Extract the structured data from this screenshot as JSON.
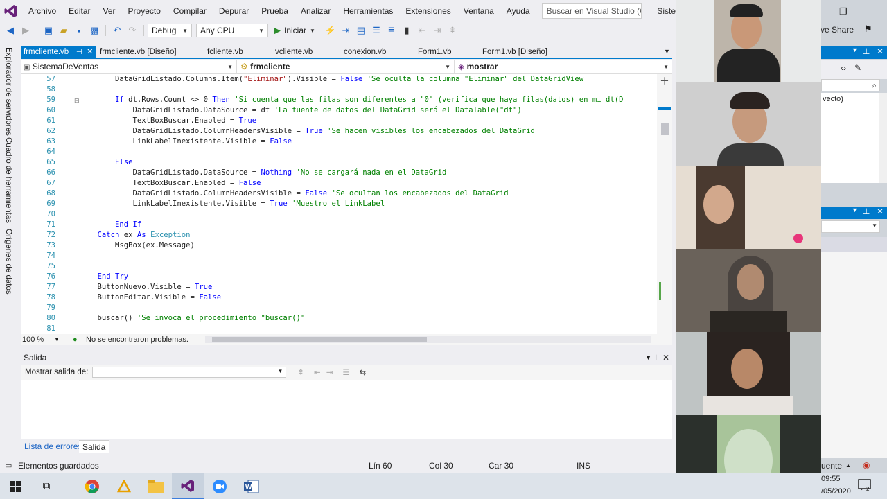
{
  "menu": [
    "Archivo",
    "Editar",
    "Ver",
    "Proyecto",
    "Compilar",
    "Depurar",
    "Prueba",
    "Analizar",
    "Herramientas",
    "Extensiones",
    "Ventana",
    "Ayuda"
  ],
  "search_placeholder": "Buscar en Visual Studio (Ctrl...",
  "search_suffix": "Siste",
  "toolbar": {
    "config": "Debug",
    "platform": "Any CPU",
    "start": "Iniciar"
  },
  "left_tabs": [
    "Explorador de servidores",
    "Cuadro de herramientas",
    "Orígenes de datos"
  ],
  "doc_tabs": [
    {
      "label": "frmcliente.vb",
      "active": true
    },
    {
      "label": "frmcliente.vb [Diseño]"
    },
    {
      "label": "fcliente.vb"
    },
    {
      "label": "vcliente.vb"
    },
    {
      "label": "conexion.vb"
    },
    {
      "label": "Form1.vb"
    },
    {
      "label": "Form1.vb [Diseño]"
    }
  ],
  "nav": {
    "project": "SistemaDeVentas",
    "class": "frmcliente",
    "member": "mostrar"
  },
  "code_lines": [
    {
      "n": "57",
      "t": [
        [
          "",
          "        DataGridListado.Columns.Item("
        ],
        [
          "st",
          "\"Eliminar\""
        ],
        [
          "",
          ").Visible = "
        ],
        [
          "kw",
          "False"
        ],
        [
          "cm",
          " 'Se oculta la columna \"Eliminar\" del DataGridView"
        ]
      ]
    },
    {
      "n": "58",
      "t": []
    },
    {
      "n": "59",
      "t": [
        [
          "kw",
          "        If"
        ],
        [
          "",
          " dt.Rows.Count <> 0 "
        ],
        [
          "kw",
          "Then"
        ],
        [
          "cm",
          " 'Si cuenta que las filas son diferentes a \"0\" (verifica que haya filas(datos) en mi dt(D"
        ]
      ]
    },
    {
      "n": "60",
      "t": [
        [
          "",
          "            DataGridListado.DataSource = dt "
        ],
        [
          "cm",
          "'La fuente de datos del DataGrid será el DataTable(\"dt\")"
        ]
      ]
    },
    {
      "n": "61",
      "t": [
        [
          "",
          "            TextBoxBuscar.Enabled = "
        ],
        [
          "kw",
          "True"
        ]
      ]
    },
    {
      "n": "62",
      "t": [
        [
          "",
          "            DataGridListado.ColumnHeadersVisible = "
        ],
        [
          "kw",
          "True"
        ],
        [
          "cm",
          " 'Se hacen visibles los encabezados del DataGrid"
        ]
      ]
    },
    {
      "n": "63",
      "t": [
        [
          "",
          "            LinkLabelInexistente.Visible = "
        ],
        [
          "kw",
          "False"
        ]
      ]
    },
    {
      "n": "64",
      "t": []
    },
    {
      "n": "65",
      "t": [
        [
          "kw",
          "        Else"
        ]
      ]
    },
    {
      "n": "66",
      "t": [
        [
          "",
          "            DataGridListado.DataSource = "
        ],
        [
          "kw",
          "Nothing"
        ],
        [
          "cm",
          " 'No se cargará nada en el DataGrid"
        ]
      ]
    },
    {
      "n": "67",
      "t": [
        [
          "",
          "            TextBoxBuscar.Enabled = "
        ],
        [
          "kw",
          "False"
        ]
      ]
    },
    {
      "n": "68",
      "t": [
        [
          "",
          "            DataGridListado.ColumnHeadersVisible = "
        ],
        [
          "kw",
          "False"
        ],
        [
          "cm",
          " 'Se ocultan los encabezados del DataGrid"
        ]
      ]
    },
    {
      "n": "69",
      "t": [
        [
          "",
          "            LinkLabelInexistente.Visible = "
        ],
        [
          "kw",
          "True"
        ],
        [
          "cm",
          " 'Muestro el LinkLabel"
        ]
      ]
    },
    {
      "n": "70",
      "t": []
    },
    {
      "n": "71",
      "t": [
        [
          "kw",
          "        End If"
        ]
      ]
    },
    {
      "n": "72",
      "t": [
        [
          "kw",
          "    Catch"
        ],
        [
          "",
          " ex "
        ],
        [
          "kw",
          "As"
        ],
        [
          "ty",
          " Exception"
        ]
      ]
    },
    {
      "n": "73",
      "t": [
        [
          "",
          "        MsgBox(ex.Message)"
        ]
      ]
    },
    {
      "n": "74",
      "t": []
    },
    {
      "n": "75",
      "t": []
    },
    {
      "n": "76",
      "t": [
        [
          "kw",
          "    End Try"
        ]
      ]
    },
    {
      "n": "77",
      "t": [
        [
          "",
          "    ButtonNuevo.Visible = "
        ],
        [
          "kw",
          "True"
        ]
      ]
    },
    {
      "n": "78",
      "t": [
        [
          "",
          "    ButtonEditar.Visible = "
        ],
        [
          "kw",
          "False"
        ]
      ]
    },
    {
      "n": "79",
      "t": []
    },
    {
      "n": "80",
      "t": [
        [
          "",
          "    buscar() "
        ],
        [
          "cm",
          "'Se invoca el procedimiento \"buscar()\""
        ]
      ]
    },
    {
      "n": "81",
      "t": []
    }
  ],
  "editor_status": {
    "zoom": "100 %",
    "issues": "No se encontraron problemas."
  },
  "output": {
    "title": "Salida",
    "show_from": "Mostrar salida de:"
  },
  "bottom_tabs": [
    "Lista de errores",
    "Salida"
  ],
  "status": {
    "left": "Elementos guardados",
    "line": "Lín 60",
    "col": "Col 30",
    "car": "Car 30",
    "mode": "INS"
  },
  "right": {
    "share": "ve Share",
    "project_suffix": "vecto)",
    "right_status": "uente",
    "time": "09:55",
    "date": "/05/2020"
  },
  "colors": {
    "accent": "#007acc",
    "keyword": "#0000ff",
    "comment": "#008000",
    "string": "#a31515"
  }
}
